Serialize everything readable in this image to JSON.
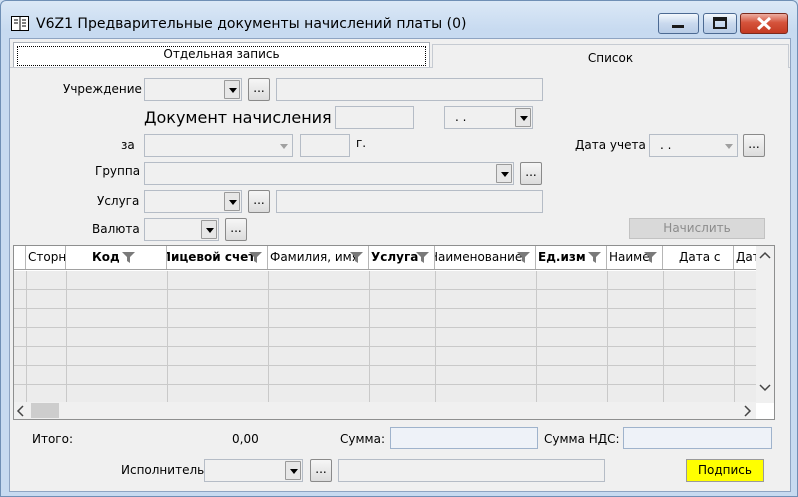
{
  "window": {
    "title": "V6Z1 Предварительные документы начислений платы (0)"
  },
  "tabs": [
    {
      "label": "Отдельная запись",
      "active": true
    },
    {
      "label": "Список",
      "active": false
    }
  ],
  "form": {
    "institution_label": "Учреждение",
    "doc_label": "Документ начисления №",
    "doc_number": "",
    "doc_date": " .  .",
    "for_label": "за",
    "year_suffix": "г.",
    "account_date_label": "Дата учета",
    "account_date": " .  .",
    "group_label": "Группа",
    "service_label": "Услуга",
    "currency_label": "Валюта",
    "calculate_button": "Начислить",
    "dots": "..."
  },
  "grid": {
    "columns": [
      {
        "label": "Сторно",
        "bold": false,
        "filter": false
      },
      {
        "label": "Код",
        "bold": true,
        "filter": true
      },
      {
        "label": "Лицевой счет",
        "bold": true,
        "filter": true
      },
      {
        "label": "Фамилия, имя",
        "bold": false,
        "filter": true
      },
      {
        "label": "Услуга",
        "bold": true,
        "filter": true
      },
      {
        "label": "Наименование",
        "bold": false,
        "filter": true
      },
      {
        "label": "Ед.изм",
        "bold": true,
        "filter": true
      },
      {
        "label": "Наиме",
        "bold": false,
        "filter": true
      },
      {
        "label": "Дата с",
        "bold": false,
        "filter": false
      },
      {
        "label": "Дата",
        "bold": false,
        "filter": false
      }
    ],
    "row_count": 7
  },
  "totals": {
    "total_label": "Итого:",
    "total_value": "0,00",
    "sum_label": "Сумма:",
    "sum_value": "",
    "vat_label": "Сумма НДС:",
    "vat_value": ""
  },
  "footer": {
    "executor_label": "Исполнитель",
    "sign_button": "Подпись"
  },
  "colors": {
    "sign_button_bg": "#ffff00",
    "close_button": "#c43a22"
  }
}
